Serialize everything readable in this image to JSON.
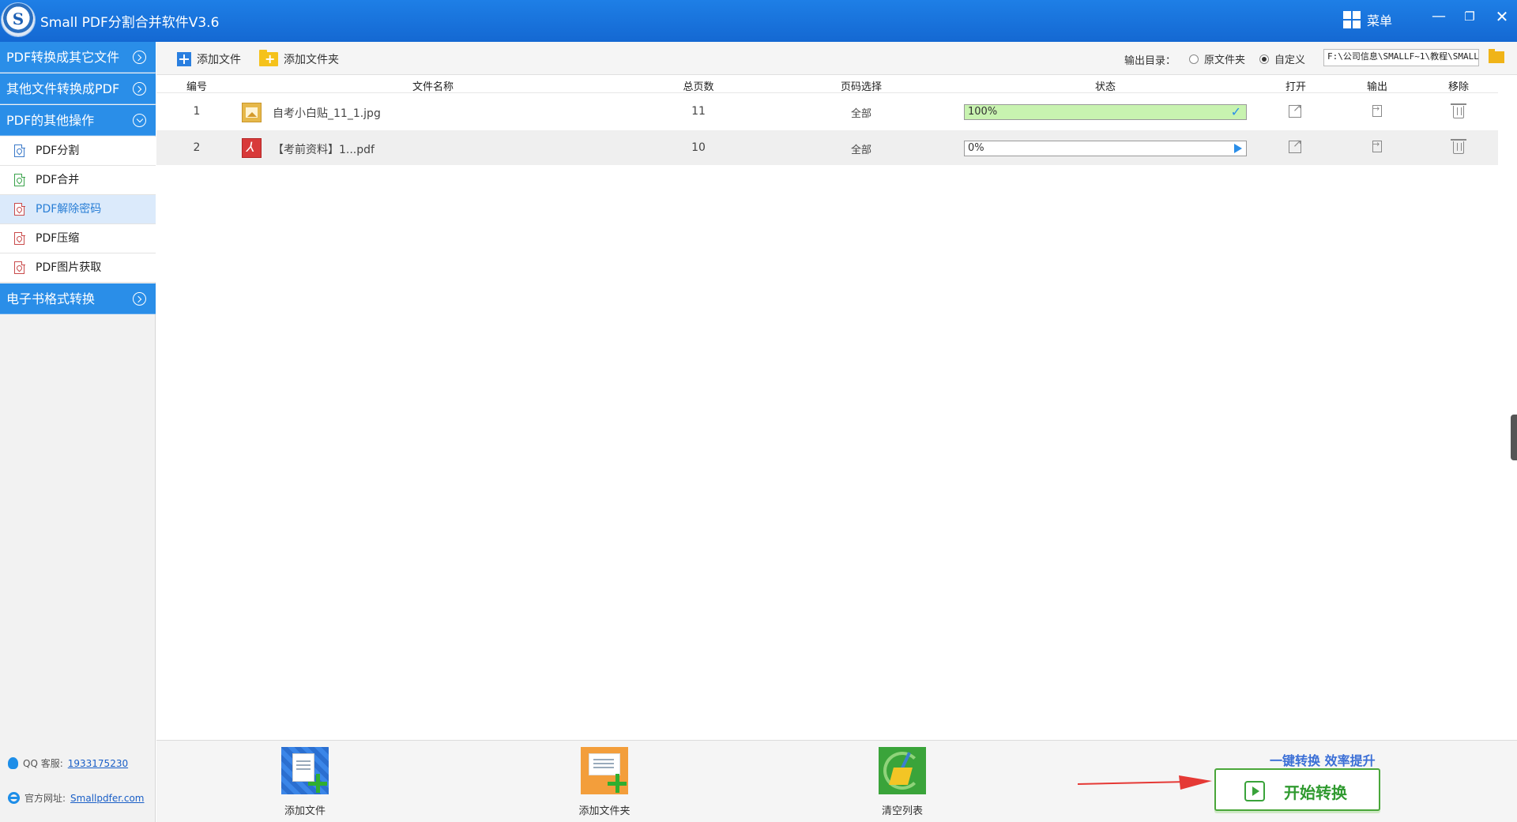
{
  "app": {
    "title": "Small PDF分割合并软件V3.6",
    "logo_letter": "S",
    "menu_label": "菜单"
  },
  "sidebar": {
    "categories": [
      {
        "label": "PDF转换成其它文件"
      },
      {
        "label": "其他文件转换成PDF"
      },
      {
        "label": "PDF的其他操作"
      },
      {
        "label": "电子书格式转换"
      }
    ],
    "sub_items": [
      {
        "label": "PDF分割"
      },
      {
        "label": "PDF合并"
      },
      {
        "label": "PDF解除密码"
      },
      {
        "label": "PDF压缩"
      },
      {
        "label": "PDF图片获取"
      }
    ],
    "qq_label": "QQ 客服:",
    "qq_value": "1933175230",
    "site_label": "官方网址:",
    "site_value": "Smallpdfer.com"
  },
  "toolbar": {
    "add_file": "添加文件",
    "add_folder": "添加文件夹",
    "output_dir_label": "输出目录：",
    "radio_original": "原文件夹",
    "radio_custom": "自定义",
    "output_path": "F:\\公司信息\\SMALLF~1\\教程\\SMALLF"
  },
  "table": {
    "headers": {
      "index": "编号",
      "filename": "文件名称",
      "pages": "总页数",
      "page_select": "页码选择",
      "status": "状态",
      "open": "打开",
      "output": "输出",
      "remove": "移除"
    },
    "rows": [
      {
        "index": "1",
        "filename": "自考小白贴_11_1.jpg",
        "pages": "11",
        "page_select": "全部",
        "progress_text": "100%",
        "progress": 1.0
      },
      {
        "index": "2",
        "filename": "【考前资料】1...pdf",
        "pages": "10",
        "page_select": "全部",
        "progress_text": "0%",
        "progress": 0.0
      }
    ]
  },
  "bottom": {
    "add_file": "添加文件",
    "add_folder": "添加文件夹",
    "clear_list": "清空列表",
    "slogan": "一键转换  效率提升",
    "start": "开始转换"
  }
}
